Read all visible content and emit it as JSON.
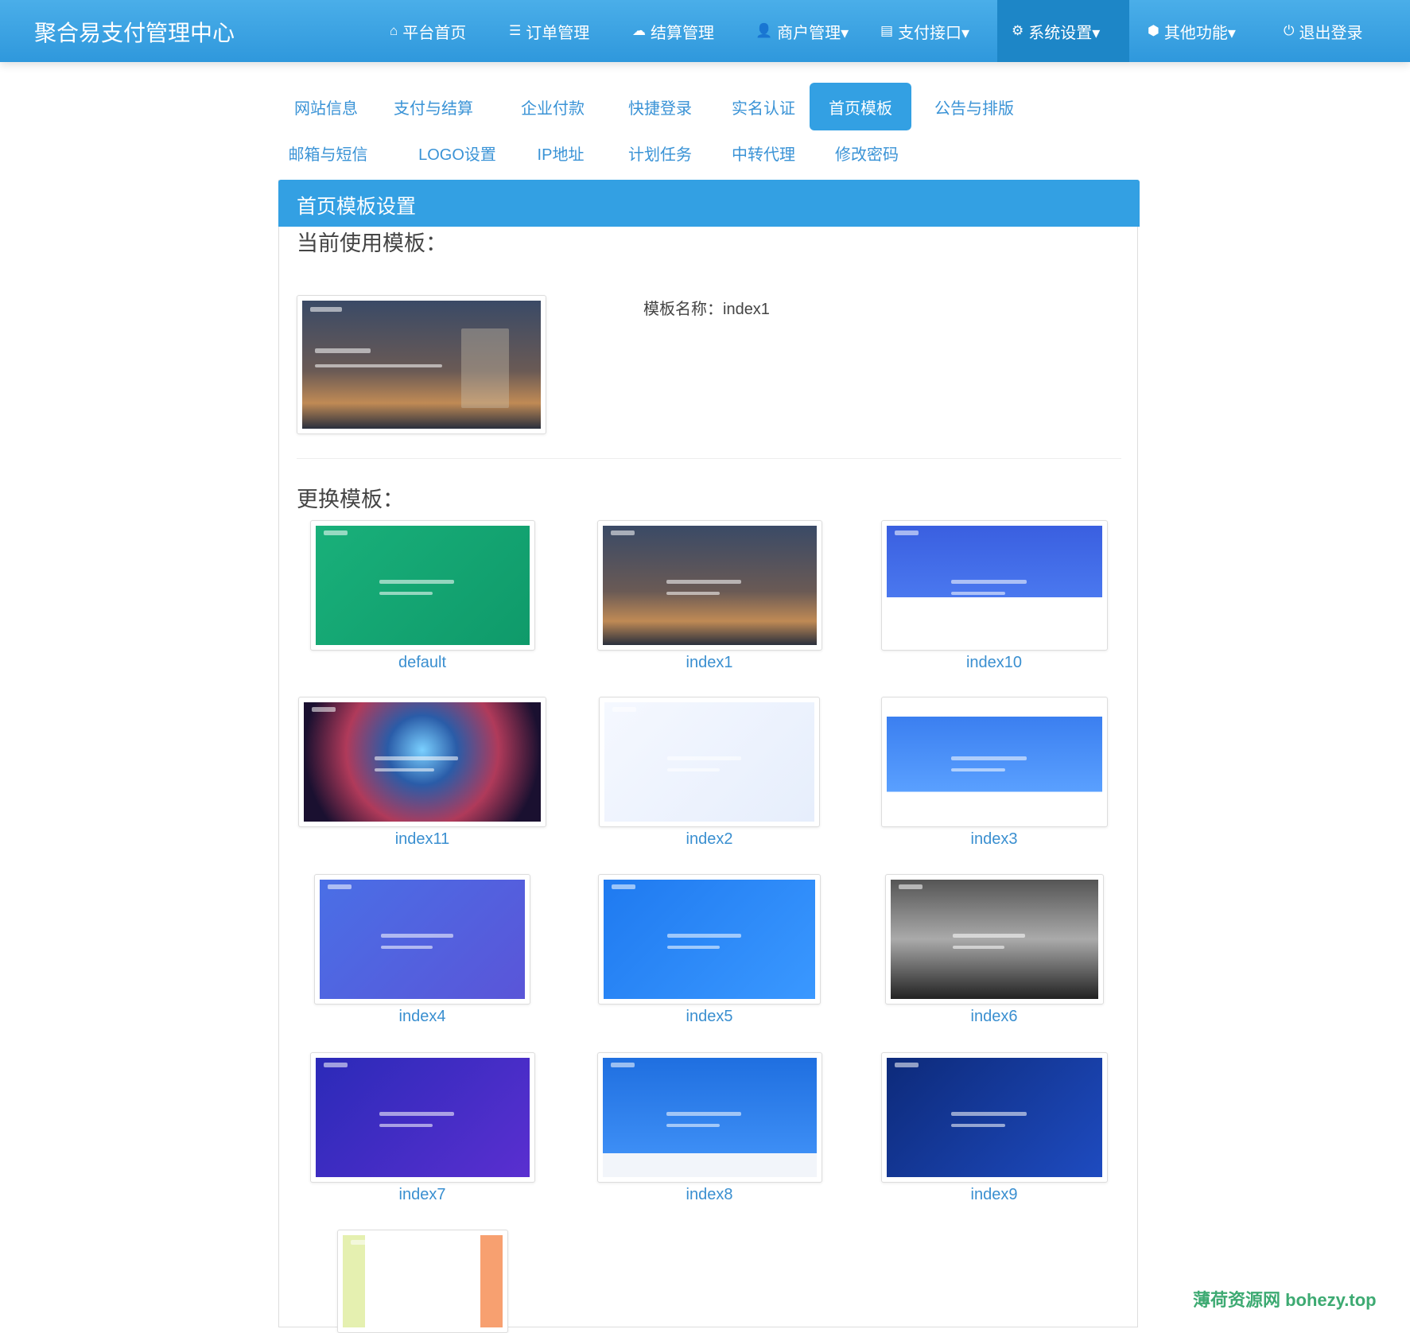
{
  "app_title": "聚合易支付管理中心",
  "nav": [
    {
      "label": "平台首页",
      "icon": "home-icon",
      "glyph": "⌂"
    },
    {
      "label": "订单管理",
      "icon": "list-icon",
      "glyph": "☰"
    },
    {
      "label": "结算管理",
      "icon": "cloud-icon",
      "glyph": "☁"
    },
    {
      "label": "商户管理▾",
      "icon": "user-icon",
      "glyph": "👤"
    },
    {
      "label": "支付接口▾",
      "icon": "credit-card-icon",
      "glyph": "▤"
    },
    {
      "label": "系统设置▾",
      "icon": "gear-icon",
      "glyph": "⚙",
      "active": true
    },
    {
      "label": "其他功能▾",
      "icon": "cube-icon",
      "glyph": "⬢"
    },
    {
      "label": "退出登录",
      "icon": "power-icon",
      "glyph": "⏻"
    }
  ],
  "subtabs": [
    "网站信息",
    "支付与结算",
    "企业付款",
    "快捷登录",
    "实名认证",
    "首页模板",
    "公告与排版",
    "邮箱与短信",
    "LOGO设置",
    "IP地址",
    "计划任务",
    "中转代理",
    "修改密码"
  ],
  "active_subtab": "首页模板",
  "panel": {
    "title": "首页模板设置",
    "current_label": "当前使用模板：",
    "current_name": "模板名称：index1",
    "change_label": "更换模板："
  },
  "templates": [
    "default",
    "index1",
    "index10",
    "index11",
    "index2",
    "index3",
    "index4",
    "index5",
    "index6",
    "index7",
    "index8",
    "index9",
    ""
  ],
  "watermark": "薄荷资源网 bohezy.top",
  "colors": {
    "header": "#33a0e3",
    "active_nav": "#1d86c7",
    "link": "#3a8fd0"
  }
}
